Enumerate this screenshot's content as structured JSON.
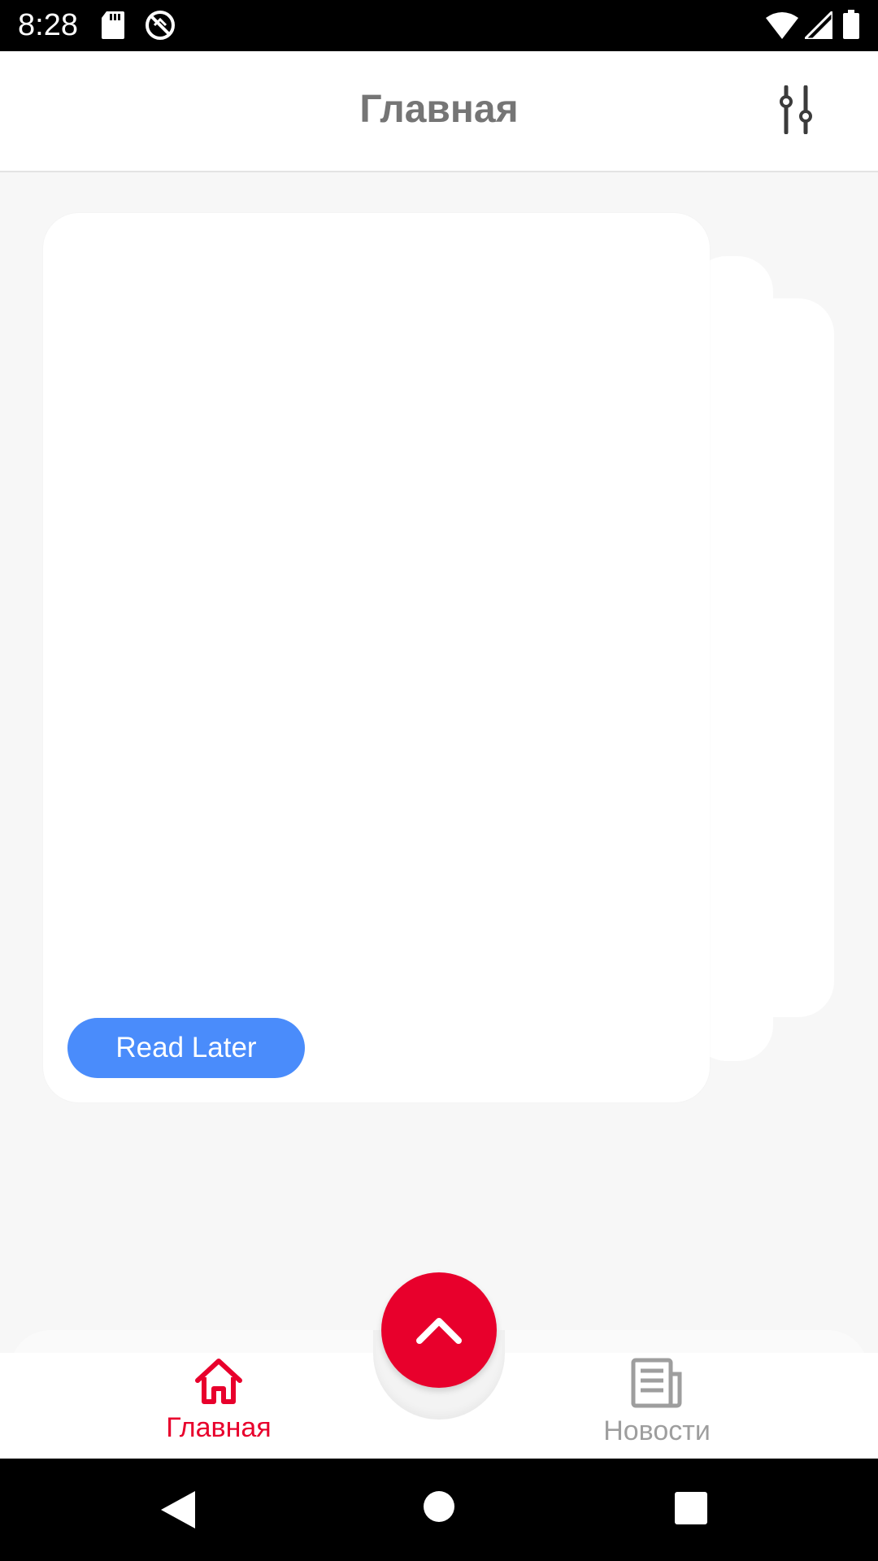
{
  "status_bar": {
    "time": "8:28",
    "icons": [
      "sd-card-icon",
      "sync-off-icon",
      "wifi-icon",
      "signal-icon",
      "battery-icon"
    ]
  },
  "app_bar": {
    "title": "Главная",
    "filter_icon": "sliders-icon"
  },
  "card": {
    "read_later_label": "Read Later"
  },
  "bottom_nav": {
    "items": [
      {
        "label": "Главная",
        "icon": "home-icon",
        "active": true
      },
      {
        "label": "Новости",
        "icon": "newspaper-icon",
        "active": false
      }
    ],
    "fab_icon": "chevron-up-icon"
  },
  "colors": {
    "accent": "#e8002c",
    "button_blue": "#4a8cfb",
    "title_gray": "#757575",
    "inactive_gray": "#9e9e9e"
  },
  "system_nav": {
    "icons": [
      "back-icon",
      "home-circle-icon",
      "recents-icon"
    ]
  }
}
